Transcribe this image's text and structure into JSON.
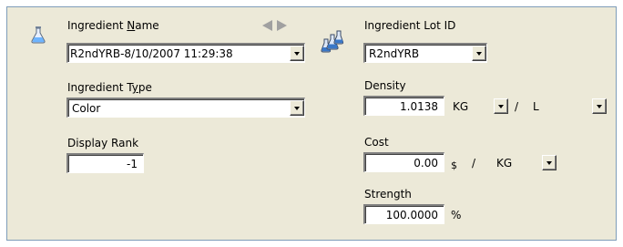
{
  "ingredient_name": {
    "label_pre": "Ingredient ",
    "label_accel": "N",
    "label_post": "ame",
    "value": "R2ndYRB-8/10/2007 11:29:38"
  },
  "ingredient_type": {
    "label_pre": "Ingredient T",
    "label_accel": "y",
    "label_post": "pe",
    "value": "Color"
  },
  "display_rank": {
    "label": "Display Rank",
    "value": "-1"
  },
  "ingredient_lot": {
    "label": "Ingredient Lot ID",
    "value": "R2ndYRB"
  },
  "density": {
    "label": "Density",
    "value": "1.0138",
    "unit_num": "KG",
    "separator": "/",
    "unit_den": "L"
  },
  "cost": {
    "label": "Cost",
    "value": "0.00",
    "currency": "$",
    "separator": "/",
    "unit": "KG"
  },
  "strength": {
    "label": "Strength",
    "value": "100.0000",
    "unit": "%"
  },
  "icons": {
    "ingredient": "flask-icon",
    "lot": "flasks-icon",
    "prev": "arrow-left-icon",
    "next": "arrow-right-icon"
  },
  "colors": {
    "panel": "#ece9d8",
    "border": "#7f9db9",
    "field_bg": "#ffffff",
    "arrow_gray": "#a0a0a0",
    "flask_blue": "#4a7fc1"
  }
}
